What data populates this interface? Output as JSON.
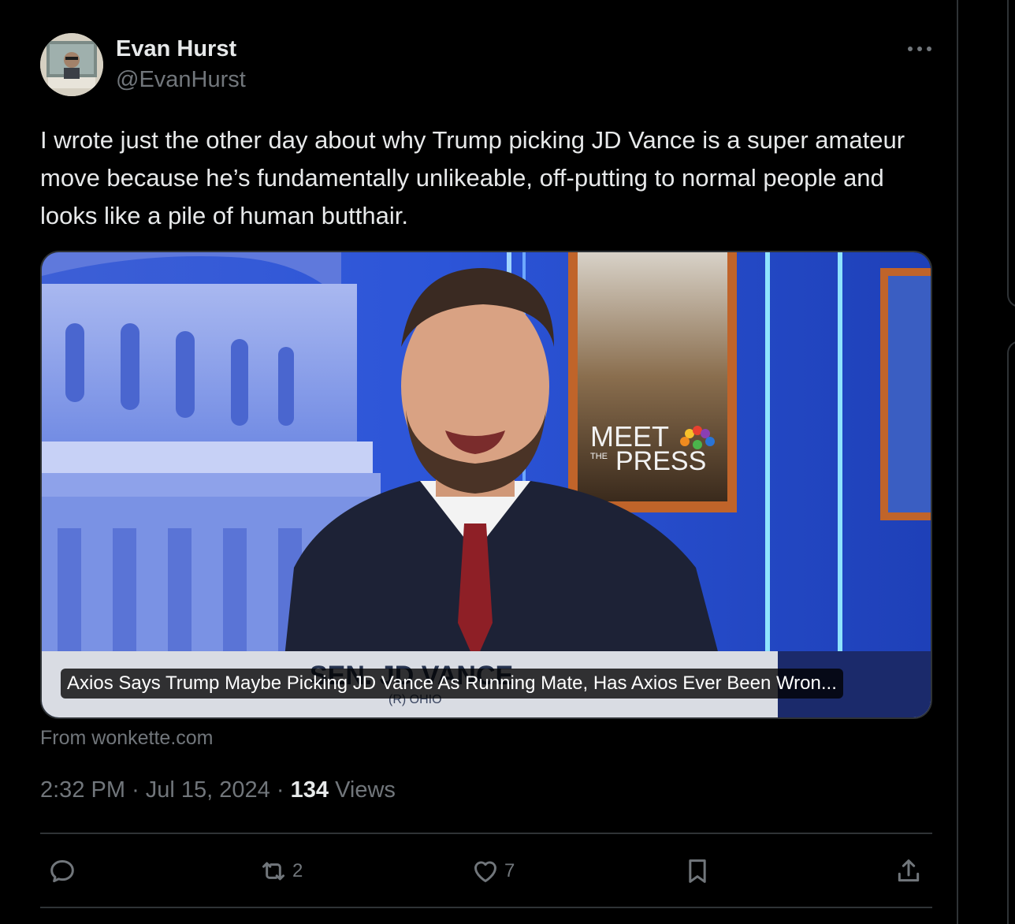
{
  "author": {
    "name": "Evan Hurst",
    "handle": "@EvanHurst"
  },
  "tweet": {
    "text": "I wrote just the other day about why Trump picking JD Vance is a super amateur move because he’s fundamentally unlikeable, off-putting to normal people and looks like a pile of human butthair."
  },
  "media": {
    "caption": "Axios Says Trump Maybe Picking JD Vance As Running Mate, Has Axios Ever Been Wron...",
    "overlay_meet": "MEET",
    "overlay_the": "THE",
    "overlay_press": "PRESS",
    "lower_third": "SEN. JD VANCE",
    "lower_third_sub": "(R) OHIO"
  },
  "source_text": "From wonkette.com",
  "meta": {
    "time": "2:32 PM",
    "date": "Jul 15, 2024",
    "separator": "·",
    "views_count": "134",
    "views_label": "Views"
  },
  "actions": {
    "reply_icon": "reply-icon",
    "repost_icon": "repost-icon",
    "repost_count": "2",
    "like_icon": "heart-icon",
    "like_count": "7",
    "bookmark_icon": "bookmark-icon",
    "share_icon": "share-icon"
  },
  "colors": {
    "background": "#000000",
    "text": "#e7e9ea",
    "secondary": "#71767b",
    "border": "#2f3336"
  }
}
